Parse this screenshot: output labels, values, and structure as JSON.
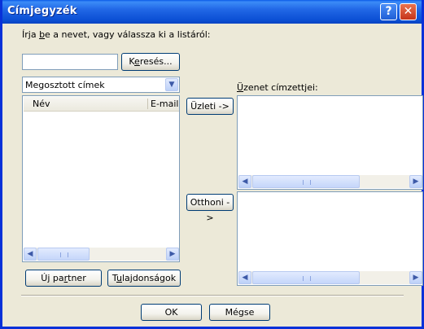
{
  "window": {
    "title": "Címjegyzék",
    "help_icon": "question-mark-icon",
    "close_icon": "close-x-icon"
  },
  "search": {
    "label_pre": "Írja ",
    "label_hotkey": "b",
    "label_post": "e a nevet, vagy válassza ki a listáról:",
    "input_value": "",
    "button_pre": "K",
    "button_hotkey": "e",
    "button_post": "resés..."
  },
  "addressbook_select": {
    "selected": "Megosztott címek",
    "dropdown_icon": "chevron-down-icon"
  },
  "contact_list": {
    "columns": [
      "Név",
      "E-mail c"
    ],
    "rows": []
  },
  "recipients": {
    "label_hotkey": "Ü",
    "label_rest": "zenet címzettjei:",
    "work_button": "Üzleti ->",
    "home_button": "Otthoni ->"
  },
  "bottom_buttons": {
    "new_contact_pre": "Új pa",
    "new_contact_hotkey": "r",
    "new_contact_post": "tner",
    "properties_pre": "T",
    "properties_hotkey": "u",
    "properties_post": "lajdonságok"
  },
  "dialog": {
    "ok": "OK",
    "cancel": "Mégse"
  },
  "scroll_icons": {
    "left": "arrow-left-icon",
    "right": "arrow-right-icon"
  }
}
